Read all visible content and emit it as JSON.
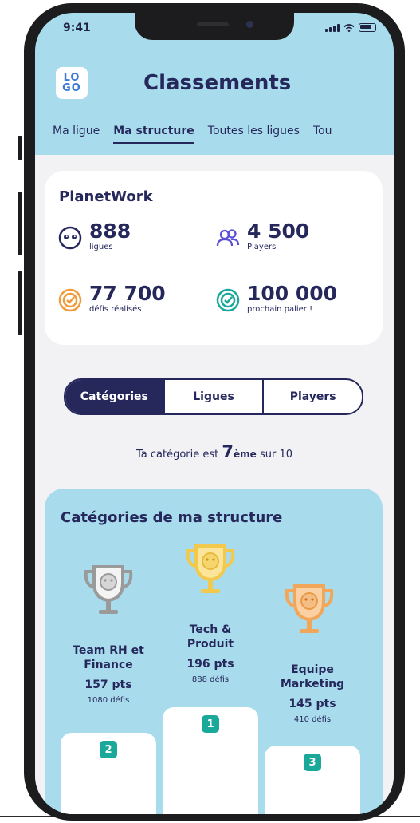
{
  "status_bar": {
    "time": "9:41"
  },
  "logo": {
    "line1": "LO",
    "line2": "GO"
  },
  "header": {
    "title": "Classements"
  },
  "tabs": [
    {
      "label": "Ma ligue",
      "active": false
    },
    {
      "label": "Ma structure",
      "active": true
    },
    {
      "label": "Toutes les ligues",
      "active": false
    },
    {
      "label": "Tou",
      "active": false
    }
  ],
  "org_card": {
    "title": "PlanetWork",
    "stats": [
      {
        "value": "888",
        "label": "ligues",
        "icon": "smiley-icon"
      },
      {
        "value": "4 500",
        "label": "Players",
        "icon": "users-icon"
      },
      {
        "value": "77 700",
        "label": "défis réalisés",
        "icon": "target-icon"
      },
      {
        "value": "100 000",
        "label": "prochain palier !",
        "icon": "target-check-icon"
      }
    ]
  },
  "segmented": {
    "options": [
      "Catégories",
      "Ligues",
      "Players"
    ],
    "selected": "Catégories"
  },
  "rank_text": {
    "prefix": "Ta catégorie est",
    "rank": "7",
    "suffix_sup": "ème",
    "suffix": "sur 10"
  },
  "podium": {
    "title": "Catégories de ma structure",
    "entries": [
      {
        "position": "2",
        "name_line1": "Team RH et",
        "name_line2": "Finance",
        "points": "157 pts",
        "challenges": "1080 défis",
        "trophy_color": "#9a9a9a"
      },
      {
        "position": "1",
        "name_line1": "Tech &",
        "name_line2": "Produit",
        "points": "196 pts",
        "challenges": "888 défis",
        "trophy_color": "#f2c94c"
      },
      {
        "position": "3",
        "name_line1": "Equipe",
        "name_line2": "Marketing",
        "points": "145 pts",
        "challenges": "410 défis",
        "trophy_color": "#f2a65a"
      }
    ]
  },
  "colors": {
    "navy": "#26285c",
    "sky": "#a8dcec",
    "teal": "#1aa89a",
    "orange": "#f29a3a"
  }
}
